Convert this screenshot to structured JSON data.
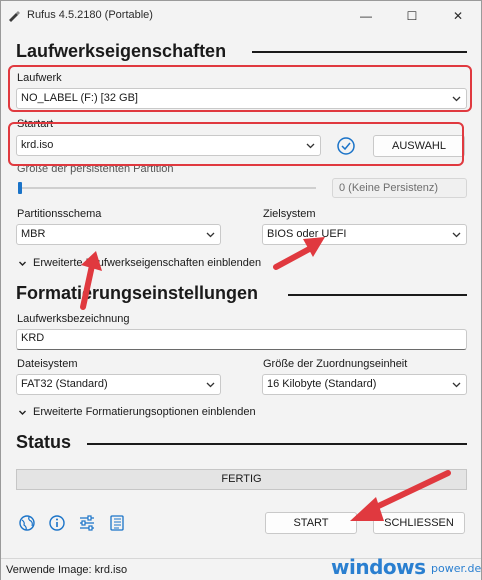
{
  "window": {
    "title": "Rufus 4.5.2180 (Portable)",
    "controls": {
      "minimize": "—",
      "maximize": "☐",
      "close": "✕"
    }
  },
  "drive_properties": {
    "section_title": "Laufwerkseigenschaften",
    "device_label": "Laufwerk",
    "device_value": "NO_LABEL (F:) [32 GB]",
    "boot_label": "Startart",
    "boot_value": "krd.iso",
    "select_button": "AUSWAHL",
    "persistence_label": "Größe der persistenten Partition",
    "persistence_value": "0 (Keine Persistenz)",
    "partition_label": "Partitionsschema",
    "partition_value": "MBR",
    "target_label": "Zielsystem",
    "target_value": "BIOS oder UEFI",
    "advanced_toggle": "Erweiterte Laufwerkseigenschaften einblenden"
  },
  "format_options": {
    "section_title": "Formatierungseinstellungen",
    "volume_label": "Laufwerksbezeichnung",
    "volume_value": "KRD",
    "filesystem_label": "Dateisystem",
    "filesystem_value": "FAT32 (Standard)",
    "cluster_label": "Größe der Zuordnungseinheit",
    "cluster_value": "16 Kilobyte (Standard)",
    "advanced_toggle": "Erweiterte Formatierungsoptionen einblenden"
  },
  "status": {
    "section_title": "Status",
    "progress_text": "FERTIG",
    "progress_value": 0
  },
  "actions": {
    "start": "START",
    "close": "SCHLIESSEN"
  },
  "statusbar": {
    "text": "Verwende Image: krd.iso"
  },
  "watermark": {
    "main": "windows",
    "sub": "power.de"
  },
  "colors": {
    "highlight_red": "#e0393f",
    "accent_blue": "#1a73c8",
    "watermark_blue": "#2a7fd0"
  },
  "icons": [
    "globe-icon",
    "info-icon",
    "settings-sliders-icon",
    "log-icon",
    "check-circle-icon",
    "usb-drive-icon"
  ]
}
